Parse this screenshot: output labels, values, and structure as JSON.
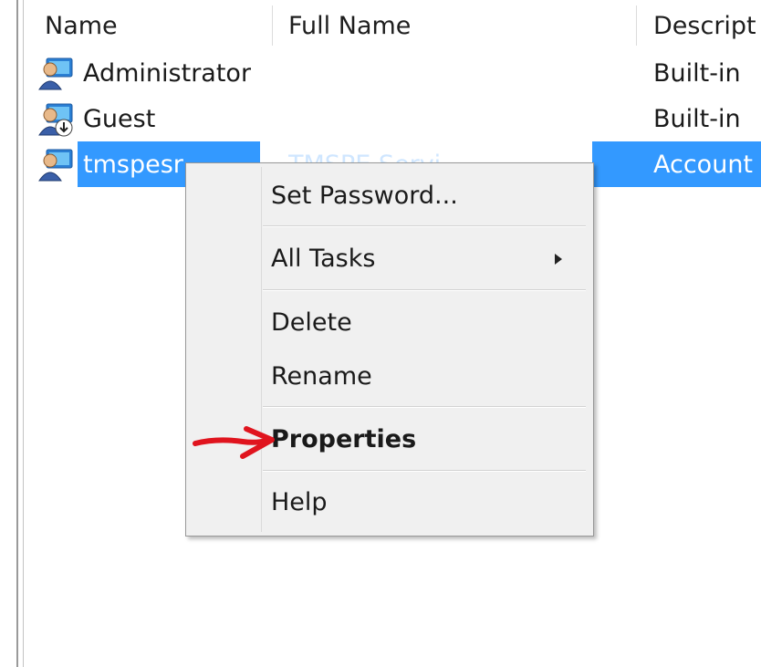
{
  "columns": [
    "Name",
    "Full Name",
    "Descript"
  ],
  "users": [
    {
      "name": "Administrator",
      "full_name": "",
      "description": "Built-in ",
      "icon": "user-admin-icon"
    },
    {
      "name": "Guest",
      "full_name": "",
      "description": "Built-in ",
      "icon": "user-guest-icon"
    },
    {
      "name": "tmspesr",
      "full_name": "TMSPE Servi",
      "description": "Account",
      "icon": "user-icon",
      "selected": true
    }
  ],
  "context_menu": {
    "items": [
      {
        "label": "Set Password...",
        "bold": false
      },
      {
        "label": "All Tasks",
        "has_submenu": true
      },
      {
        "label": "Delete"
      },
      {
        "label": "Rename"
      },
      {
        "label": "Properties",
        "bold": true
      },
      {
        "label": "Help"
      }
    ]
  },
  "colors": {
    "selection": "#3399ff",
    "menu_bg": "#f0f0f0",
    "annotation": "#e0141e"
  }
}
